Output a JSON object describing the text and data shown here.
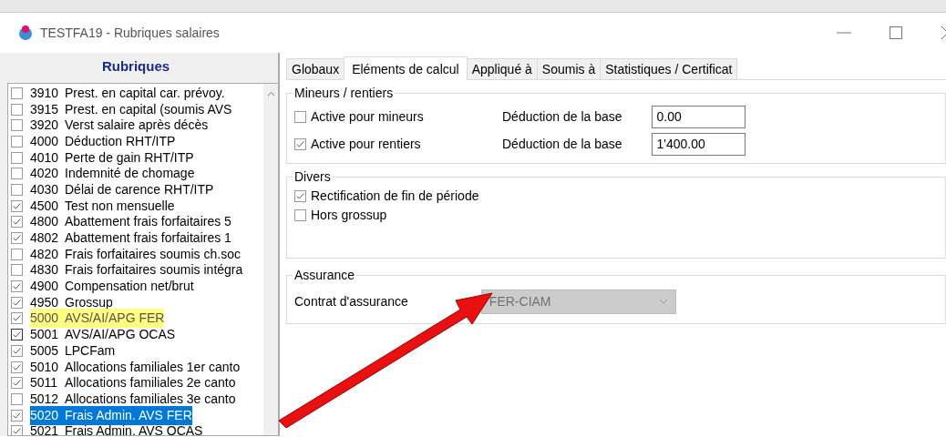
{
  "window": {
    "title": "TESTFA19 - Rubriques salaires"
  },
  "sidebar": {
    "title": "Rubriques",
    "items": [
      {
        "code": "3910",
        "label": "Prest. en capital car. prévoy.",
        "checked": false,
        "selected": false,
        "highlighted": false
      },
      {
        "code": "3915",
        "label": "Prest. en capital (soumis AVS",
        "checked": false,
        "selected": false,
        "highlighted": false
      },
      {
        "code": "3920",
        "label": "Verst salaire après décès",
        "checked": false,
        "selected": false,
        "highlighted": false
      },
      {
        "code": "4000",
        "label": "Déduction RHT/ITP",
        "checked": false,
        "selected": false,
        "highlighted": false
      },
      {
        "code": "4010",
        "label": "Perte de gain RHT/ITP",
        "checked": false,
        "selected": false,
        "highlighted": false
      },
      {
        "code": "4020",
        "label": "Indemnité de chomage",
        "checked": false,
        "selected": false,
        "highlighted": false
      },
      {
        "code": "4030",
        "label": "Délai de carence RHT/ITP",
        "checked": false,
        "selected": false,
        "highlighted": false
      },
      {
        "code": "4500",
        "label": "Test non mensuelle",
        "checked": true,
        "selected": false,
        "highlighted": false
      },
      {
        "code": "4800",
        "label": "Abattement frais forfaitaires 5",
        "checked": true,
        "selected": false,
        "highlighted": false
      },
      {
        "code": "4802",
        "label": "Abattement frais forfaitaires 1",
        "checked": true,
        "selected": false,
        "highlighted": false
      },
      {
        "code": "4820",
        "label": "Frais forfaitaires soumis ch.soc",
        "checked": false,
        "selected": false,
        "highlighted": false
      },
      {
        "code": "4830",
        "label": "Frais forfaitaires soumis intégra",
        "checked": false,
        "selected": false,
        "highlighted": false
      },
      {
        "code": "4900",
        "label": "Compensation net/brut",
        "checked": true,
        "selected": false,
        "highlighted": false
      },
      {
        "code": "4950",
        "label": "Grossup",
        "checked": true,
        "selected": false,
        "highlighted": false
      },
      {
        "code": "5000",
        "label": "AVS/AI/APG FER",
        "checked": true,
        "selected": false,
        "highlighted": true
      },
      {
        "code": "5001",
        "label": "AVS/AI/APG OCAS",
        "checked": true,
        "selected": false,
        "highlighted": false
      },
      {
        "code": "5005",
        "label": "LPCFam",
        "checked": true,
        "selected": false,
        "highlighted": false
      },
      {
        "code": "5010",
        "label": "Allocations familiales 1er canto",
        "checked": true,
        "selected": false,
        "highlighted": false
      },
      {
        "code": "5011",
        "label": "Allocations familiales 2e canto",
        "checked": true,
        "selected": false,
        "highlighted": false
      },
      {
        "code": "5012",
        "label": "Allocations familiales 3e canto",
        "checked": false,
        "selected": false,
        "highlighted": false
      },
      {
        "code": "5020",
        "label": "Frais Admin. AVS FER",
        "checked": true,
        "selected": true,
        "highlighted": false
      },
      {
        "code": "5021",
        "label": "Frais Admin. AVS OCAS",
        "checked": true,
        "selected": false,
        "highlighted": false
      }
    ]
  },
  "tabs": [
    {
      "label": "Globaux",
      "selected": false
    },
    {
      "label": "Eléments de calcul",
      "selected": true
    },
    {
      "label": "Appliqué à",
      "selected": false
    },
    {
      "label": "Soumis à",
      "selected": false
    },
    {
      "label": "Statistiques / Certificat",
      "selected": false
    }
  ],
  "groups": [
    {
      "title": "Mineurs / rentiers",
      "rows": [
        {
          "kind": "checkfield",
          "label": "Active pour mineurs",
          "checked": false,
          "field_label": "Déduction de la base",
          "value": "0.00"
        },
        {
          "kind": "checkfield",
          "label": "Active pour rentiers",
          "checked": true,
          "field_label": "Déduction de la base",
          "value": "1'400.00"
        }
      ]
    },
    {
      "title": "Divers",
      "rows": [
        {
          "kind": "check",
          "label": "Rectification de fin de période",
          "checked": true
        },
        {
          "kind": "check",
          "label": "Hors grossup",
          "checked": false
        }
      ]
    },
    {
      "title": "Assurance",
      "rows": [
        {
          "kind": "select",
          "label": "Contrat d'assurance",
          "value": "FER-CIAM",
          "disabled": true
        }
      ]
    }
  ]
}
